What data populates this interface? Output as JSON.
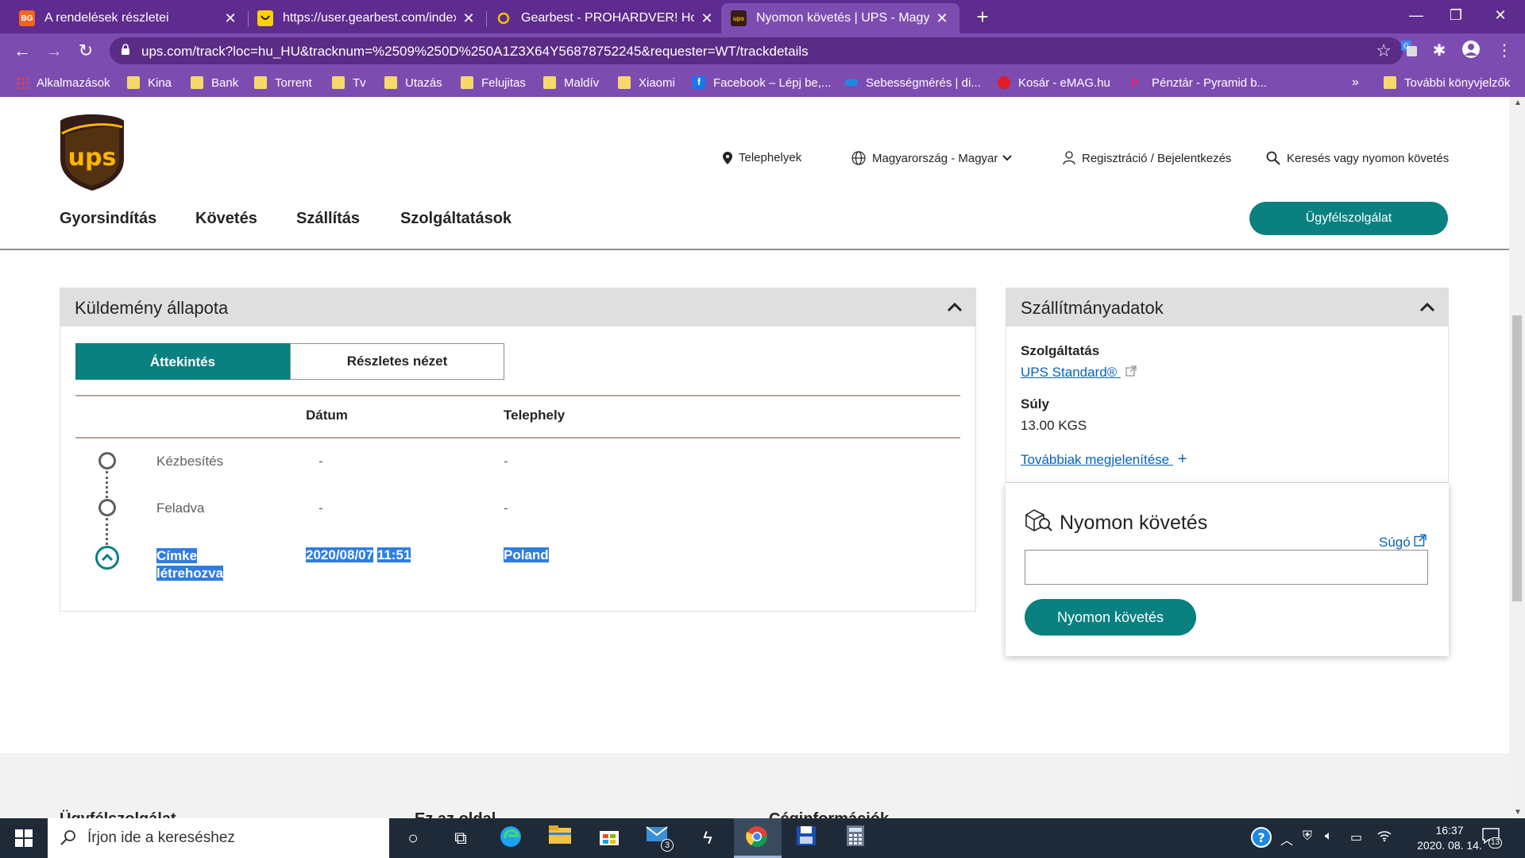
{
  "browser": {
    "tabs": [
      {
        "title": "A rendelések részletei",
        "favicon": "BG",
        "favicon_color": "#f26522",
        "active": false
      },
      {
        "title": "https://user.gearbest.com/index#",
        "favicon": "",
        "favicon_color": "#ffd000",
        "active": false
      },
      {
        "title": "Gearbest - PROHARDVER! Hozzá",
        "favicon": "",
        "favicon_color": "#f2c300",
        "active": false
      },
      {
        "title": "Nyomon követés | UPS - Magyar",
        "favicon": "ups",
        "favicon_color": "#351c15",
        "active": true
      }
    ],
    "url": "ups.com/track?loc=hu_HU&tracknum=%2509%250D%250A1Z3X64Y56878752245&requester=WT/trackdetails",
    "bookmarks": [
      {
        "label": "Alkalmazások",
        "icon": "apps-grid-icon"
      },
      {
        "label": "Kina",
        "icon": "folder-icon"
      },
      {
        "label": "Bank",
        "icon": "folder-icon"
      },
      {
        "label": "Torrent",
        "icon": "folder-icon"
      },
      {
        "label": "Tv",
        "icon": "folder-icon"
      },
      {
        "label": "Utazás",
        "icon": "folder-icon"
      },
      {
        "label": "Felujitas",
        "icon": "folder-icon"
      },
      {
        "label": "Maldív",
        "icon": "folder-icon"
      },
      {
        "label": "Xiaomi",
        "icon": "folder-icon"
      },
      {
        "label": "Facebook – Lépj be,...",
        "icon": "facebook-icon"
      },
      {
        "label": "Sebességmérés | di...",
        "icon": "speedtest-icon"
      },
      {
        "label": "Kosár - eMAG.hu",
        "icon": "emag-icon"
      },
      {
        "label": "Pénztár - Pyramid b...",
        "icon": "pyramid-icon"
      }
    ],
    "bookmarks_overflow": "»",
    "other_bookmarks": "További könyvjelzők"
  },
  "header": {
    "util": {
      "locations": "Telephelyek",
      "language": "Magyarország - Magyar",
      "login": "Regisztráció / Bejelentkezés",
      "search": "Keresés vagy nyomon követés"
    },
    "nav": [
      "Gyorsindítás",
      "Követés",
      "Szállítás",
      "Szolgáltatások"
    ],
    "cta": "Ügyfélszolgálat"
  },
  "status_card": {
    "title": "Küldemény állapota",
    "tabs": {
      "overview": "Áttekintés",
      "detailed": "Részletes nézet"
    },
    "columns": {
      "date": "Dátum",
      "location": "Telephely"
    },
    "rows": [
      {
        "status": "Kézbesítés",
        "date": "-",
        "location": "-"
      },
      {
        "status": "Feladva",
        "date": "-",
        "location": "-"
      }
    ],
    "current": {
      "status_line1": "Címke",
      "status_line2": "létrehozva",
      "date": "2020/08/07",
      "time": "11:51",
      "location": "Poland"
    }
  },
  "shipment_card": {
    "title": "Szállítmányadatok",
    "service_label": "Szolgáltatás",
    "service_value": "UPS Standard®",
    "weight_label": "Súly",
    "weight_value": "13.00 KGS",
    "more": "Továbbiak megjelenítése"
  },
  "track_card": {
    "title": "Nyomon követés",
    "help": "Súgó",
    "input_value": "",
    "button": "Nyomon követés"
  },
  "footer": {
    "headings": [
      "Ügyfélszolgálat",
      "Ez az oldal",
      "Céginformációk"
    ]
  },
  "taskbar": {
    "search_placeholder": "Írjon ide a kereséshez",
    "mail_badge": "3",
    "time": "16:37",
    "date": "2020. 08. 14.",
    "notifications": "13"
  },
  "colors": {
    "chrome": "#7d4cb0",
    "ups_teal": "#0a8080",
    "link": "#0662bb",
    "selection": "#2f7de1"
  }
}
